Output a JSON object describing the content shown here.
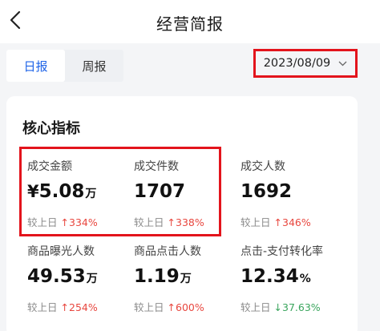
{
  "header": {
    "title": "经营简报"
  },
  "tabs": [
    {
      "label": "日报",
      "active": true
    },
    {
      "label": "周报",
      "active": false
    }
  ],
  "date_picker": {
    "value": "2023/08/09"
  },
  "card": {
    "title": "核心指标",
    "compare_label": "较上日",
    "metrics": [
      {
        "label": "成交金额",
        "prefix": "¥",
        "value": "5.08",
        "unit": "万",
        "change": "334%",
        "direction": "up"
      },
      {
        "label": "成交件数",
        "prefix": "",
        "value": "1707",
        "unit": "",
        "change": "338%",
        "direction": "up"
      },
      {
        "label": "成交人数",
        "prefix": "",
        "value": "1692",
        "unit": "",
        "change": "346%",
        "direction": "up"
      },
      {
        "label": "商品曝光人数",
        "prefix": "",
        "value": "49.53",
        "unit": "万",
        "change": "254%",
        "direction": "up"
      },
      {
        "label": "商品点击人数",
        "prefix": "",
        "value": "1.19",
        "unit": "万",
        "change": "600%",
        "direction": "up"
      },
      {
        "label": "点击-支付转化率",
        "prefix": "",
        "value": "12.34",
        "unit": "%",
        "change": "37.63%",
        "direction": "down"
      }
    ]
  },
  "colors": {
    "accent": "#1f64e8",
    "highlight": "#e3141c",
    "up": "#e8473f",
    "down": "#3aa55d"
  },
  "icons": {
    "back": "chevron-left-icon",
    "dropdown": "chevron-down-icon",
    "up": "arrow-up-icon",
    "down": "arrow-down-icon"
  }
}
